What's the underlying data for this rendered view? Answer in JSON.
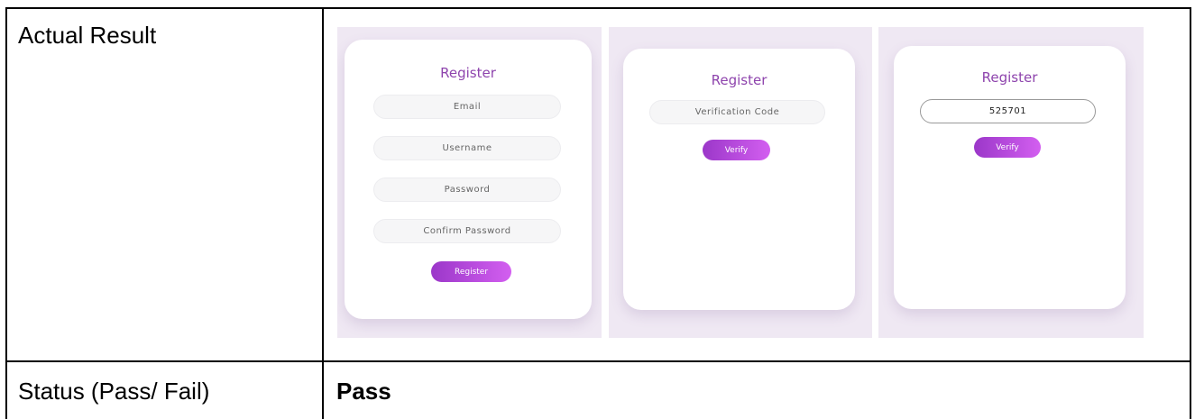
{
  "table": {
    "rows": [
      {
        "label": "Actual Result"
      },
      {
        "label": "Status (Pass/ Fail)",
        "value": "Pass"
      }
    ]
  },
  "screens": [
    {
      "title": "Register",
      "fields": [
        {
          "placeholder": "Email"
        },
        {
          "placeholder": "Username"
        },
        {
          "placeholder": "Password"
        },
        {
          "placeholder": "Confirm Password"
        }
      ],
      "button": "Register"
    },
    {
      "title": "Register",
      "fields": [
        {
          "placeholder": "Verification Code"
        }
      ],
      "button": "Verify"
    },
    {
      "title": "Register",
      "fields": [
        {
          "value": "525701"
        }
      ],
      "button": "Verify"
    }
  ],
  "colors": {
    "accent": "#8e44ad",
    "button_gradient_start": "#9b37c9",
    "button_gradient_end": "#d35ff0",
    "screenshot_background": "#efe8f3"
  }
}
